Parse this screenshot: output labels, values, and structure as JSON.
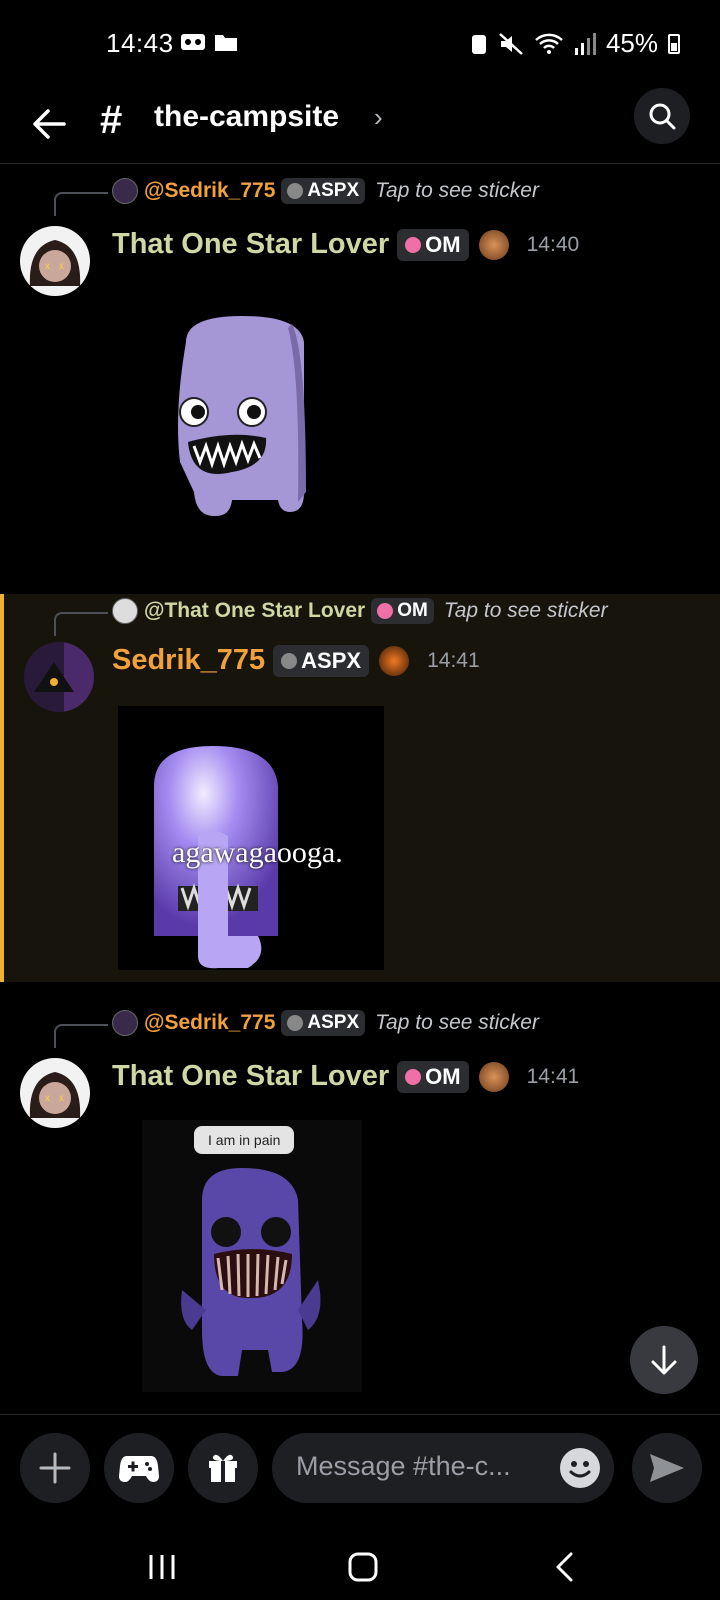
{
  "status": {
    "time": "14:43",
    "battery": "45%"
  },
  "header": {
    "channel_name": "the-campsite"
  },
  "messages": [
    {
      "reply_to": "@Sedrik_775",
      "reply_tag": "ASPX",
      "reply_text": "Tap to see sticker",
      "author": "That One Star Lover",
      "author_color": "#cfd8a4",
      "tag": "OM",
      "time": "14:40"
    },
    {
      "reply_to": "@That One Star Lover",
      "reply_tag": "OM",
      "reply_text": "Tap to see sticker",
      "author": "Sedrik_775",
      "author_color": "#f0a13c",
      "tag": "ASPX",
      "time": "14:41",
      "sticker_caption": "agawagaooga."
    },
    {
      "reply_to": "@Sedrik_775",
      "reply_tag": "ASPX",
      "reply_text": "Tap to see sticker",
      "author": "That One Star Lover",
      "author_color": "#cfd8a4",
      "tag": "OM",
      "time": "14:41",
      "sticker_caption": "I am in pain"
    }
  ],
  "composer": {
    "placeholder": "Message #the-c..."
  },
  "colors": {
    "accent_highlight": "#f0b232",
    "background": "#000000",
    "mention_orange": "#f0a13c"
  }
}
